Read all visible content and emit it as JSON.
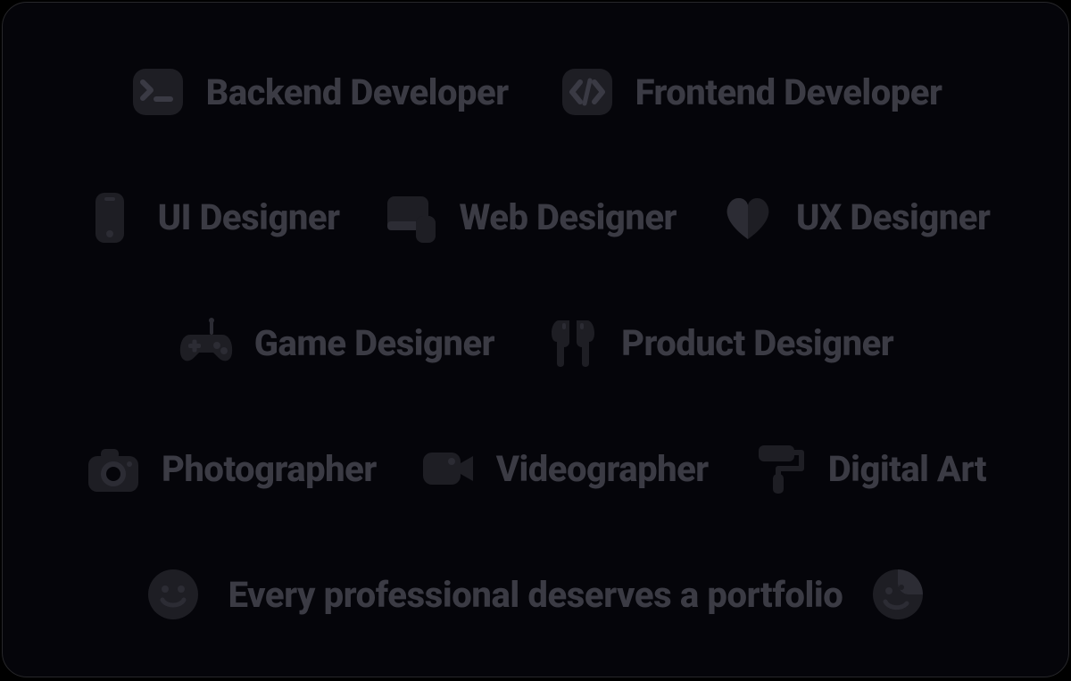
{
  "rows": [
    {
      "items": [
        {
          "icon": "terminal-icon",
          "label": "Backend Developer"
        },
        {
          "icon": "code-icon",
          "label": "Frontend Developer"
        }
      ]
    },
    {
      "items": [
        {
          "icon": "mobile-icon",
          "label": "UI Designer"
        },
        {
          "icon": "desktop-icon",
          "label": "Web Designer"
        },
        {
          "icon": "heart-icon",
          "label": "UX Designer"
        }
      ]
    },
    {
      "items": [
        {
          "icon": "gamepad-icon",
          "label": "Game Designer"
        },
        {
          "icon": "earbuds-icon",
          "label": "Product Designer"
        }
      ]
    },
    {
      "items": [
        {
          "icon": "camera-icon",
          "label": "Photographer"
        },
        {
          "icon": "video-camera-icon",
          "label": "Videographer"
        },
        {
          "icon": "paint-roller-icon",
          "label": "Digital Art"
        }
      ]
    }
  ],
  "footer": {
    "left_icon": "smiley-icon",
    "right_icon": "sticker-smiley-icon",
    "message": "Every professional deserves a portfolio"
  }
}
